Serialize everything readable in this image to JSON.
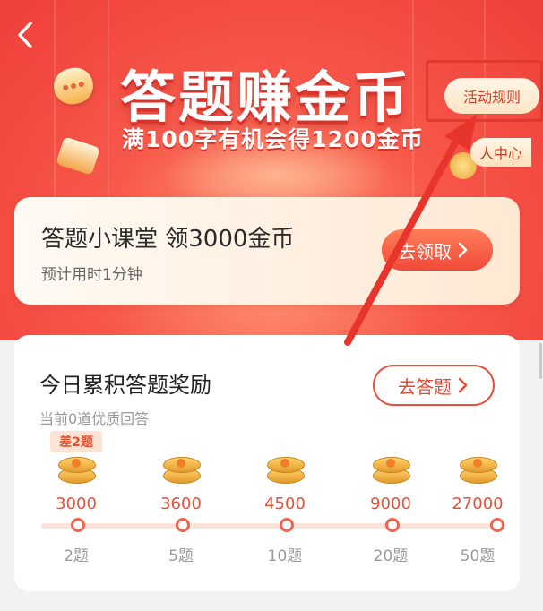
{
  "hero": {
    "title": "答题赚金币",
    "subtitle": "满100字有机会得1200金币",
    "rules_label": "活动规则",
    "personal_center_label": "人中心"
  },
  "lesson": {
    "title": "答题小课堂 领3000金币",
    "subtitle": "预计用时1分钟",
    "button_label": "去领取"
  },
  "rewards": {
    "title": "今日累积答题奖励",
    "subtitle": "当前0道优质回答",
    "button_label": "去答题",
    "gap_badge": "差2题",
    "milestones": [
      {
        "coins": "3000",
        "questions": "2题"
      },
      {
        "coins": "3600",
        "questions": "5题"
      },
      {
        "coins": "4500",
        "questions": "10题"
      },
      {
        "coins": "9000",
        "questions": "20题"
      },
      {
        "coins": "27000",
        "questions": "50题"
      }
    ]
  },
  "colors": {
    "accent": "#f04a38",
    "hero_red": "#ef3f3a",
    "coin_gold": "#f0b64a"
  },
  "icons": [
    "back-icon",
    "chat-bubble-icon",
    "notebook-icon",
    "chevron-right-icon",
    "coin-icon"
  ]
}
